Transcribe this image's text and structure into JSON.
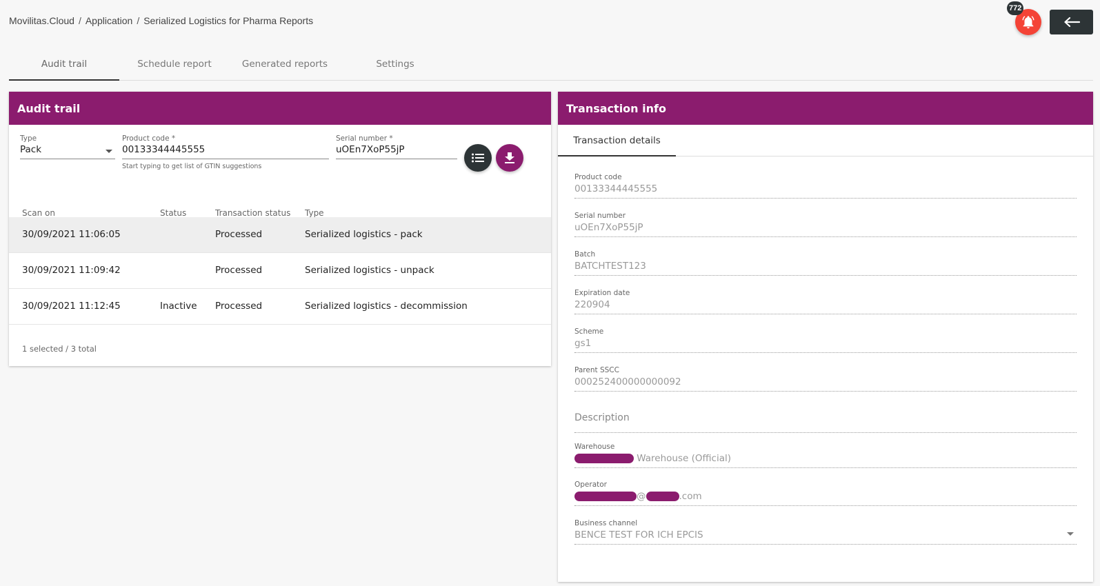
{
  "breadcrumb": {
    "items": [
      "Movilitas.Cloud",
      "Application",
      "Serialized Logistics for Pharma Reports"
    ],
    "separator": "/"
  },
  "notifications": {
    "count": "772",
    "icon": "bell-icon"
  },
  "back_button": {
    "icon": "arrow-left-icon"
  },
  "tabs": [
    {
      "label": "Audit trail",
      "active": true
    },
    {
      "label": "Schedule report",
      "active": false
    },
    {
      "label": "Generated reports",
      "active": false
    },
    {
      "label": "Settings",
      "active": false
    }
  ],
  "audit": {
    "title": "Audit trail",
    "type_field": {
      "label": "Type",
      "value": "Pack"
    },
    "product_field": {
      "label": "Product code *",
      "value": "00133344445555",
      "hint": "Start typing to get list of GTIN suggestions"
    },
    "serial_field": {
      "label": "Serial number *",
      "value": "uOEn7XoP55jP"
    },
    "columns": [
      "Scan on",
      "Status",
      "Transaction status",
      "Type"
    ],
    "rows": [
      {
        "scan_on": "30/09/2021 11:06:05",
        "status": "",
        "tx_status": "Processed",
        "type": "Serialized logistics - pack",
        "selected": true
      },
      {
        "scan_on": "30/09/2021 11:09:42",
        "status": "",
        "tx_status": "Processed",
        "type": "Serialized logistics - unpack",
        "selected": false
      },
      {
        "scan_on": "30/09/2021 11:12:45",
        "status": "Inactive",
        "tx_status": "Processed",
        "type": "Serialized logistics - decommission",
        "selected": false
      }
    ],
    "footer": "1 selected / 3 total"
  },
  "transaction": {
    "title": "Transaction info",
    "subtab": "Transaction details",
    "fields": {
      "product_code": {
        "label": "Product code",
        "value": "00133344445555"
      },
      "serial_number": {
        "label": "Serial number",
        "value": "uOEn7XoP55jP"
      },
      "batch": {
        "label": "Batch",
        "value": "BATCHTEST123"
      },
      "expiration": {
        "label": "Expiration date",
        "value": "220904"
      },
      "scheme": {
        "label": "Scheme",
        "value": "gs1"
      },
      "parent_sscc": {
        "label": "Parent SSCC",
        "value": "000252400000000092"
      },
      "description": {
        "label": "Description"
      },
      "warehouse": {
        "label": "Warehouse",
        "value": "Warehouse (Official)"
      },
      "operator": {
        "label": "Operator",
        "value_at": "@",
        "value_suffix": ".com"
      },
      "business_channel": {
        "label": "Business channel",
        "value": "BENCE TEST FOR ICH EPCIS"
      }
    }
  },
  "colors": {
    "accent": "#8b1c6e",
    "alert": "#f44336",
    "dark": "#2d3436"
  }
}
